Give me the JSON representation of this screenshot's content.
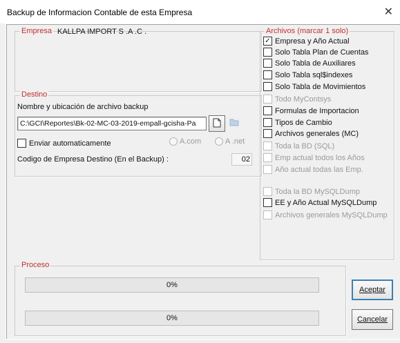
{
  "window": {
    "title": "Backup de Informacion Contable de esta Empresa"
  },
  "empresa": {
    "label": "Empresa",
    "value": "KALLPA IMPORT S .A .C ."
  },
  "destino": {
    "label": "Destino",
    "file_label": "Nombre y ubicación de archivo backup",
    "file_value": "C:\\GCI\\Reportes\\Bk-02-MC-03-2019-empall-gcisha-Pa",
    "enviar_label": "Enviar automaticamente",
    "radio_com": "A.com",
    "radio_net": "A .net",
    "codigo_label": "Codigo de Empresa Destino (En el Backup) :",
    "codigo_value": "02"
  },
  "archivos": {
    "label": "Archivos (marcar 1 solo)",
    "items": [
      {
        "label": "Empresa y Año Actual",
        "checked": true,
        "enabled": true
      },
      {
        "label": "Solo Tabla Plan de Cuentas",
        "checked": false,
        "enabled": true
      },
      {
        "label": "Solo Tabla de Auxiliares",
        "checked": false,
        "enabled": true
      },
      {
        "label": "Solo Tabla sql$indexes",
        "checked": false,
        "enabled": true
      },
      {
        "label": "Solo Tabla de Movimientos",
        "checked": false,
        "enabled": true
      },
      {
        "label": "Todo MyContsys",
        "checked": false,
        "enabled": false
      },
      {
        "label": "Formulas de Importacion",
        "checked": false,
        "enabled": true
      },
      {
        "label": "Tipos de Cambio",
        "checked": false,
        "enabled": true
      },
      {
        "label": "Archivos generales (MC)",
        "checked": false,
        "enabled": true
      },
      {
        "label": "Toda la BD (SQL)",
        "checked": false,
        "enabled": false
      },
      {
        "label": "Emp actual todos los Años",
        "checked": false,
        "enabled": false
      },
      {
        "label": "Año actual todas las Emp.",
        "checked": false,
        "enabled": false
      },
      {
        "label": "Toda la BD MySQLDump",
        "checked": false,
        "enabled": false
      },
      {
        "label": "EE y Año Actual MySQLDump",
        "checked": false,
        "enabled": true
      },
      {
        "label": "Archivos generales MySQLDump",
        "checked": false,
        "enabled": false
      }
    ]
  },
  "proceso": {
    "label": "Proceso",
    "bar1_text": "0%",
    "bar1_value": 0,
    "bar2_text": "0%",
    "bar2_value": 0
  },
  "buttons": {
    "aceptar": "Aceptar",
    "cancelar": "Cancelar"
  },
  "colors": {
    "group_label": "#c03030",
    "progress_fill": "#2eb82e"
  },
  "icons": {
    "close": "close-icon",
    "browse": "document-icon",
    "folder": "folder-icon"
  }
}
